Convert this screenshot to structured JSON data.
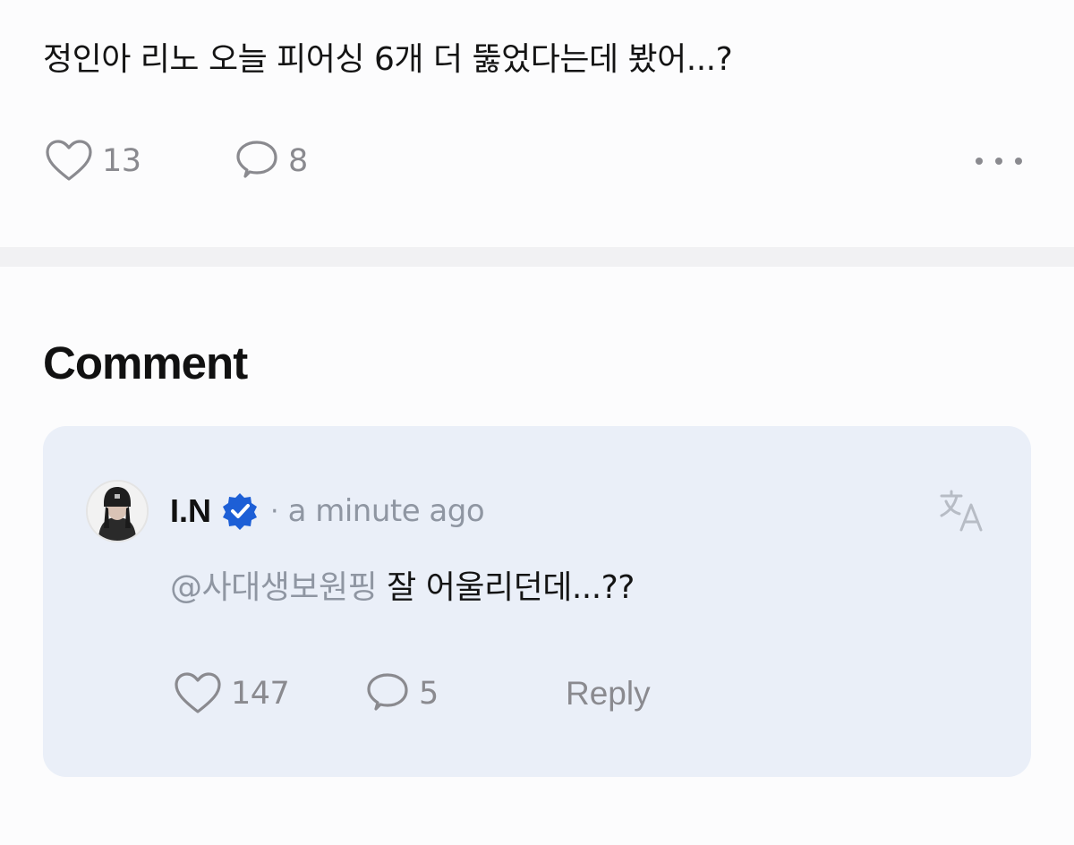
{
  "post": {
    "text": "정인아 리노 오늘 피어싱 6개 더 뚫었다는데 봤어...?",
    "like_count": "13",
    "comment_count": "8"
  },
  "comments_section": {
    "title": "Comment"
  },
  "comment": {
    "author": "I.N",
    "separator": "·",
    "time": "a minute ago",
    "mention": "@사대생보원핑",
    "text": " 잘 어울리던데...??",
    "like_count": "147",
    "reply_count": "5",
    "reply_label": "Reply"
  },
  "colors": {
    "background": "#fcfcfd",
    "divider": "#f1f1f3",
    "card_background": "#eaeff8",
    "muted_text": "#8a8a8f",
    "verified_badge": "#1d5fd6"
  },
  "icons": {
    "post_like": "heart-outline-icon",
    "post_comment": "speech-bubble-icon",
    "post_more": "more-horizontal-icon",
    "verified": "verified-badge-icon",
    "translate": "translate-icon",
    "comment_like": "heart-outline-icon",
    "comment_reply": "speech-bubble-icon"
  }
}
